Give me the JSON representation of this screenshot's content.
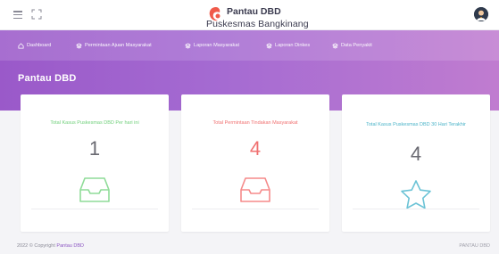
{
  "app": {
    "title": "Pantau DBD",
    "subtitle": "Puskesmas Bangkinang"
  },
  "nav": {
    "items": [
      {
        "label": "Dashboard",
        "icon": "home-icon"
      },
      {
        "label": "Permintaan Ajuan Masyarakat",
        "icon": "layers-icon"
      },
      {
        "label": "Laporan Masyarakat",
        "icon": "layers-icon"
      },
      {
        "label": "Laporan Dinkes",
        "icon": "layers-icon"
      },
      {
        "label": "Data Penyakit",
        "icon": "layers-icon"
      }
    ]
  },
  "page": {
    "title": "Pantau DBD"
  },
  "cards": [
    {
      "title": "Total Kasus Puskesmas DBD Per hari ini",
      "value": "1",
      "color": "#6fcf7a",
      "value_color": "#6a6a72",
      "icon": "inbox-icon"
    },
    {
      "title": "Total Permintaan Tindakan Masyarakat",
      "value": "4",
      "color": "#f07070",
      "value_color": "#f07070",
      "icon": "inbox-icon"
    },
    {
      "title": "Total Kasus Puskesmas DBD 30 Hari Terakhir",
      "value": "4",
      "color": "#4ab3c8",
      "value_color": "#6a6a72",
      "icon": "star-icon"
    }
  ],
  "footer": {
    "copyright_prefix": "2022 © Copyright",
    "copyright_link": "Pantau DBD",
    "brand": "PANTAU DBD"
  },
  "colors": {
    "accent": "#9a59c9",
    "link": "#8c56c2"
  }
}
